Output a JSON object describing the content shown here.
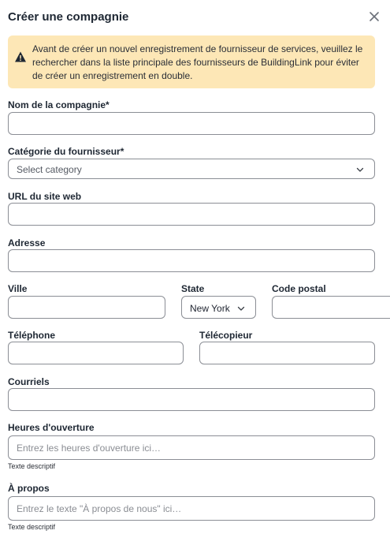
{
  "dialog": {
    "title": "Créer une compagnie"
  },
  "alert": {
    "text": "Avant de créer un nouvel enregistrement de fournisseur de services, veuillez le rechercher dans la liste principale des fournisseurs de BuildingLink pour éviter de créer un enregistrement en double."
  },
  "form": {
    "company_name": {
      "label": "Nom de la compagnie*",
      "value": ""
    },
    "category": {
      "label": "Catégorie du fournisseur*",
      "selected": "Select category"
    },
    "website": {
      "label": "URL du site web",
      "value": ""
    },
    "address": {
      "label": "Adresse",
      "value": ""
    },
    "city": {
      "label": "Ville",
      "value": ""
    },
    "state": {
      "label": "State",
      "selected": "New York"
    },
    "postal_code": {
      "label": "Code postal",
      "value": ""
    },
    "phone": {
      "label": "Téléphone",
      "value": ""
    },
    "fax": {
      "label": "Télécopieur",
      "value": ""
    },
    "emails": {
      "label": "Courriels",
      "value": ""
    },
    "hours": {
      "label": "Heures d'ouverture",
      "placeholder": "Entrez les heures d'ouverture ici…",
      "help": "Texte descriptif"
    },
    "about": {
      "label": "À propos",
      "placeholder": "Entrez le texte \"À propos de nous\" ici…",
      "help": "Texte descriptif"
    }
  },
  "icons": {
    "close": "close-icon",
    "alert": "warning-icon",
    "chevron": "chevron-down-icon"
  },
  "colors": {
    "alert_bg": "#fde7b6",
    "border": "#8b8e95",
    "title": "#1e2733"
  }
}
